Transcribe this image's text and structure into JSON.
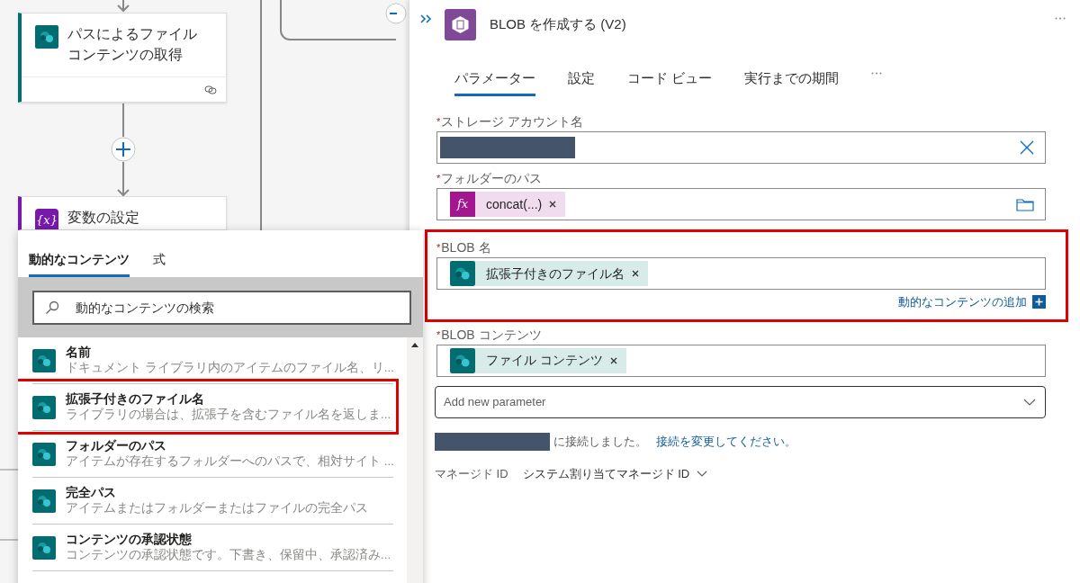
{
  "canvas": {
    "cards": [
      {
        "title": "パスによるファイルコンテンツの取得",
        "kind": "sharepoint"
      },
      {
        "title": "変数の設定",
        "kind": "variable",
        "icon": "{x}"
      }
    ]
  },
  "dynamic_content": {
    "tabs": [
      {
        "label": "動的なコンテンツ",
        "selected": true
      },
      {
        "label": "式",
        "selected": false
      }
    ],
    "search": {
      "placeholder": "動的なコンテンツの検索"
    },
    "items": [
      {
        "title": "名前",
        "description": "ドキュメント ライブラリ内のアイテムのファイル名、リ...",
        "highlighted": false
      },
      {
        "title": "拡張子付きのファイル名",
        "description": "ライブラリの場合は、拡張子を含むファイル名を返しま...",
        "highlighted": true
      },
      {
        "title": "フォルダーのパス",
        "description": "アイテムが存在するフォルダーへのパスで、相対サイト ...",
        "highlighted": false
      },
      {
        "title": "完全パス",
        "description": "アイテムまたはフォルダーまたはファイルの完全パス",
        "highlighted": false
      },
      {
        "title": "コンテンツの承認状態",
        "description": "コンテンツの承認状態です。下書き、保留中、承認済み...",
        "highlighted": false
      }
    ]
  },
  "panel": {
    "title": "BLOB を作成する (V2)",
    "tabs": [
      {
        "label": "パラメーター",
        "selected": true
      },
      {
        "label": "設定",
        "selected": false
      },
      {
        "label": "コード ビュー",
        "selected": false
      },
      {
        "label": "実行までの期間",
        "selected": false
      }
    ],
    "fields": [
      {
        "label": "ストレージ アカウント名",
        "required_mark": "*",
        "kind": "redacted",
        "highlighted": false
      },
      {
        "label": "フォルダーのパス",
        "required_mark": "*",
        "kind": "tokens",
        "highlighted": false,
        "tokens": [
          {
            "text": "concat(...)",
            "kind": "expression",
            "icon": "fx"
          }
        ]
      },
      {
        "label": "BLOB 名",
        "required_mark": "*",
        "kind": "tokens",
        "highlighted": true,
        "tokens": [
          {
            "text": "拡張子付きのファイル名",
            "kind": "sharepoint"
          }
        ],
        "add_dynamic": "動的なコンテンツの追加"
      },
      {
        "label": "BLOB コンテンツ",
        "required_mark": "*",
        "kind": "tokens",
        "highlighted": false,
        "tokens": [
          {
            "text": "ファイル コンテンツ",
            "kind": "sharepoint"
          }
        ]
      }
    ],
    "add_parameter": {
      "placeholder": "Add new parameter"
    },
    "connection": {
      "text": "に接続しました。",
      "link": "接続を変更してください。"
    },
    "managed_identity": {
      "label": "マネージド ID",
      "value": "システム割り当てマネージド ID"
    }
  }
}
